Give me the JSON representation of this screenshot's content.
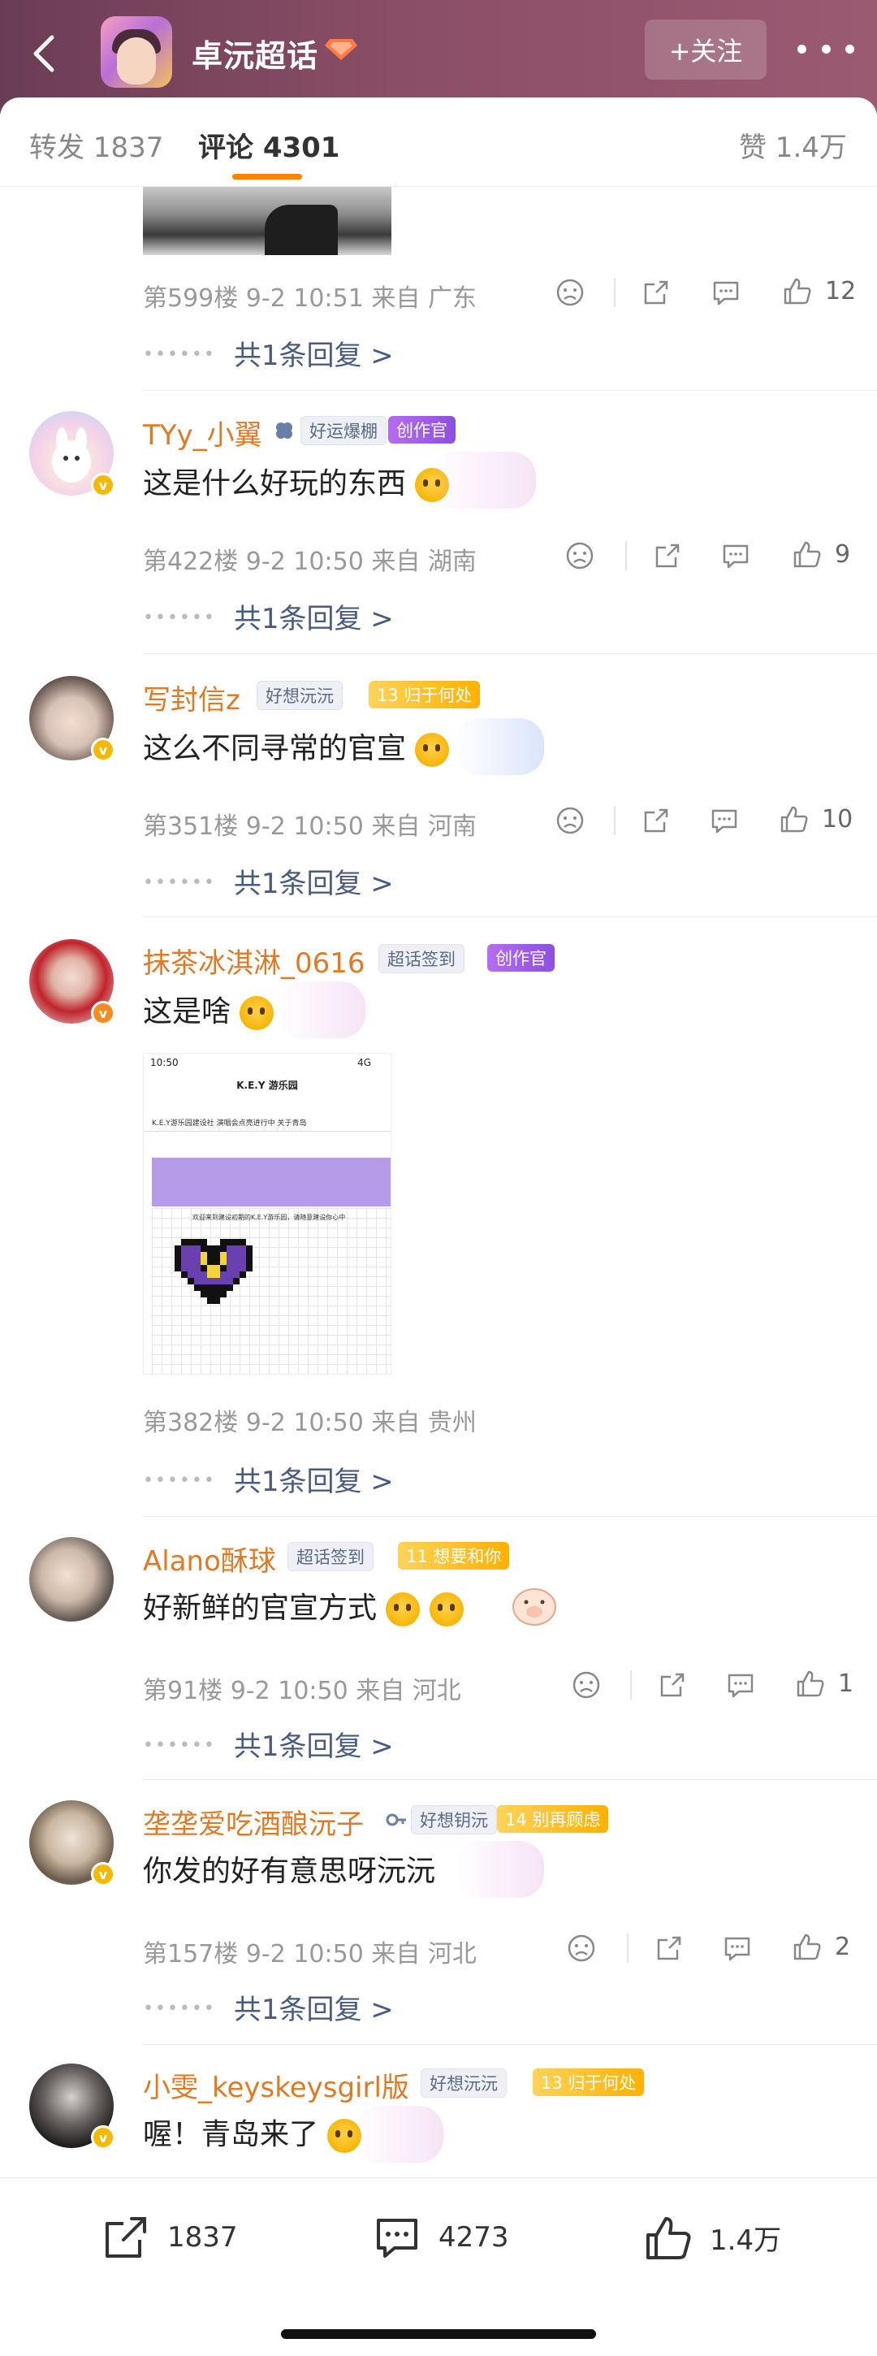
{
  "header": {
    "title": "卓沅超话",
    "follow_label": "+关注"
  },
  "tabs": {
    "repost": "转发 1837",
    "comment": "评论 4301",
    "like": "赞 1.4万"
  },
  "comments": [
    {
      "floor": "第599楼  9-2 10:51  来自 广东",
      "likes": "12",
      "replies": "共1条回复 >"
    },
    {
      "user": "TYy_小翼",
      "tag1": "好运爆棚",
      "tag2": "创作官",
      "text": "这是什么好玩的东西",
      "floor": "第422楼  9-2 10:50  来自 湖南",
      "likes": "9",
      "replies": "共1条回复 >"
    },
    {
      "user": "写封信z",
      "tag1": "好想沅沅",
      "tag2": "13 归于何处",
      "text": "这么不同寻常的官宣",
      "floor": "第351楼  9-2 10:50  来自 河南",
      "likes": "10",
      "replies": "共1条回复 >"
    },
    {
      "user": "抹茶冰淇淋_0616",
      "tag1": "超话签到",
      "tag2": "创作官",
      "text": "这是啥",
      "image": {
        "time": "10:50",
        "signal": "4G",
        "title": "K.E.Y 游乐园",
        "tabs": "K.E.Y游乐园建设社  演唱会点亮进行中  关于青岛",
        "welcome": "欢迎来到建设初期的K.E.Y游乐园，请随意建设你心中"
      },
      "floor": "第382楼  9-2 10:50  来自 贵州",
      "replies": "共1条回复 >"
    },
    {
      "user": "Alano酥球",
      "tag1": "超话签到",
      "tag2": "11 想要和你",
      "text": "好新鲜的官宣方式",
      "floor": "第91楼  9-2 10:50  来自 河北",
      "likes": "1",
      "replies": "共1条回复 >"
    },
    {
      "user": "垄垄爱吃酒酿沅子",
      "tag1": "好想钥沅",
      "tag2": "14 别再顾虑",
      "text": "你发的好有意思呀沅沅",
      "floor": "第157楼  9-2 10:50  来自 河北",
      "likes": "2",
      "replies": "共1条回复 >"
    },
    {
      "user": "小雯_keyskeysgirl版",
      "tag1": "好想沅沅",
      "tag2": "13 归于何处",
      "text": "喔！青岛来了"
    }
  ],
  "bottom_bar": {
    "repost": "1837",
    "comment": "4273",
    "like": "1.4万"
  },
  "colors": {
    "header_bg": "#7b4760",
    "username": "#e07a25",
    "reply_link": "#4a5b80",
    "tab_indicator": "#ff8200"
  }
}
